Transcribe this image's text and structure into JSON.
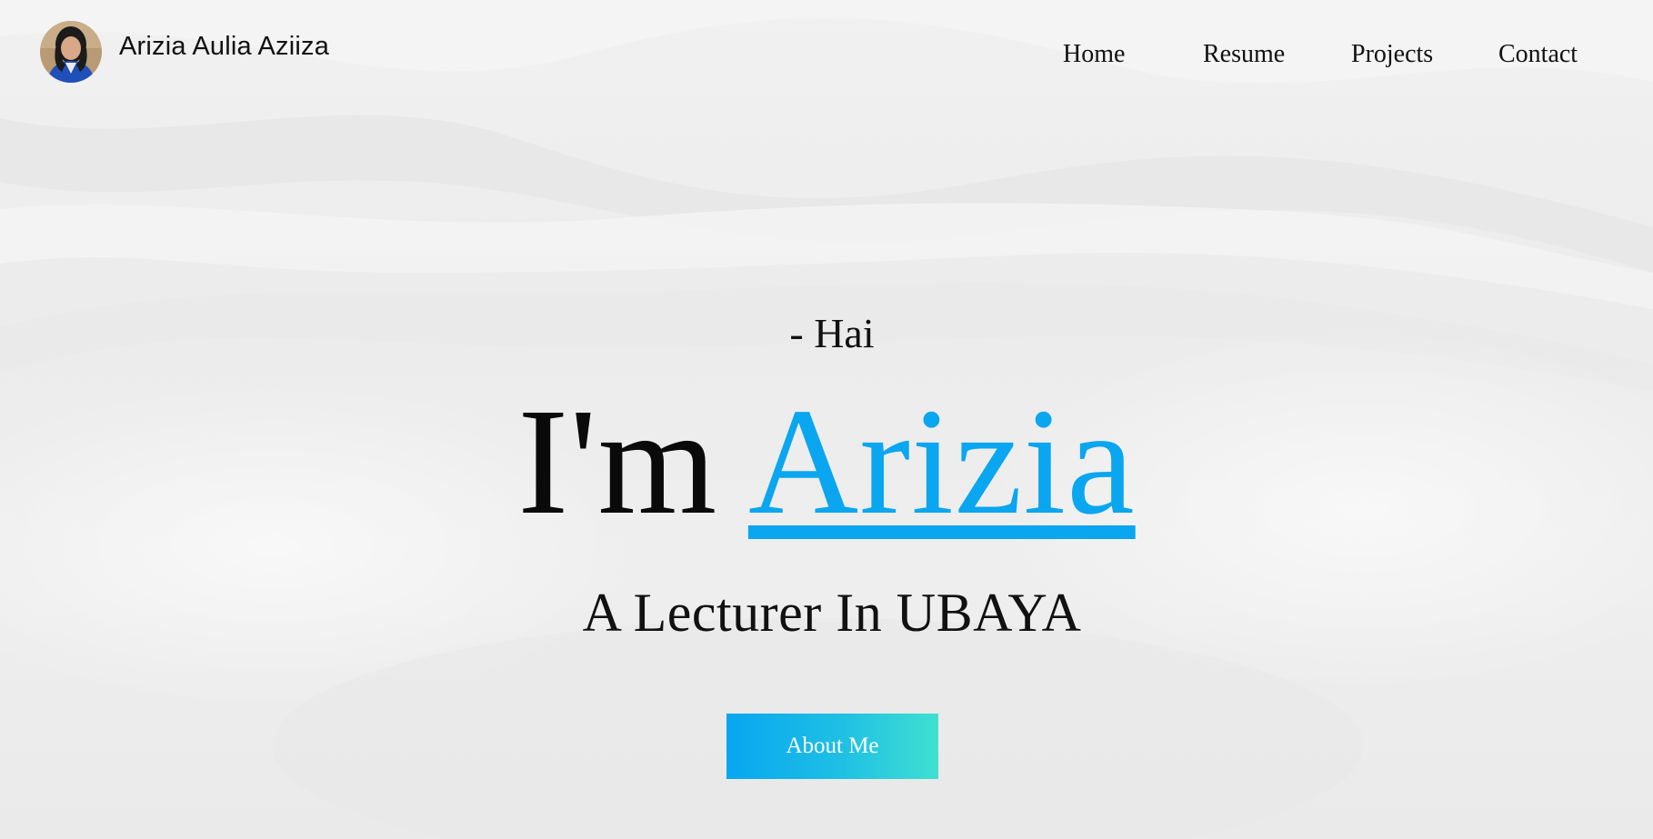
{
  "header": {
    "brand_name": "Arizia Aulia Aziiza",
    "avatar_icon": "profile-photo",
    "nav": [
      {
        "label": "Home"
      },
      {
        "label": "Resume"
      },
      {
        "label": "Projects"
      },
      {
        "label": "Contact"
      }
    ]
  },
  "hero": {
    "greeting": "- Hai",
    "headline_prefix": "I'm",
    "headline_name": "Arizia",
    "subtitle": "A Lecturer In UBAYA",
    "cta_label": "About Me"
  },
  "colors": {
    "accent": "#0aa6ef",
    "button_gradient_start": "#07a6f0",
    "button_gradient_end": "#3fe0d0",
    "text": "#0a0a0a",
    "background": "#eeeeee"
  }
}
